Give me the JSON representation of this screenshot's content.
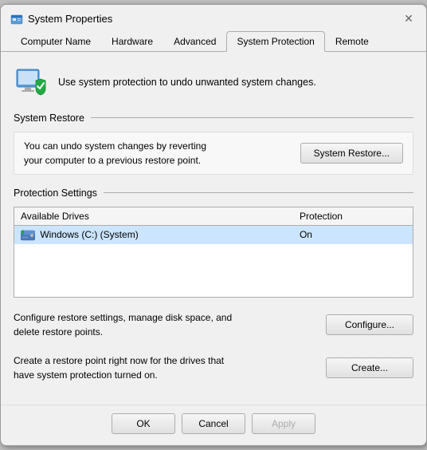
{
  "window": {
    "title": "System Properties",
    "close_label": "✕"
  },
  "tabs": [
    {
      "id": "computer-name",
      "label": "Computer Name",
      "active": false
    },
    {
      "id": "hardware",
      "label": "Hardware",
      "active": false
    },
    {
      "id": "advanced",
      "label": "Advanced",
      "active": false
    },
    {
      "id": "system-protection",
      "label": "System Protection",
      "active": true
    },
    {
      "id": "remote",
      "label": "Remote",
      "active": false
    }
  ],
  "intro": {
    "text": "Use system protection to undo unwanted system changes."
  },
  "system_restore": {
    "section_title": "System Restore",
    "description": "You can undo system changes by reverting\nyour computer to a previous restore point.",
    "button_label": "System Restore..."
  },
  "protection_settings": {
    "section_title": "Protection Settings",
    "table": {
      "columns": [
        "Available Drives",
        "Protection"
      ],
      "rows": [
        {
          "drive": "Windows (C:) (System)",
          "protection": "On",
          "selected": true
        }
      ]
    },
    "configure": {
      "description": "Configure restore settings, manage disk space, and\ndelete restore points.",
      "button_label": "Configure..."
    },
    "create": {
      "description": "Create a restore point right now for the drives that\nhave system protection turned on.",
      "button_label": "Create..."
    }
  },
  "footer": {
    "ok_label": "OK",
    "cancel_label": "Cancel",
    "apply_label": "Apply"
  },
  "colors": {
    "accent": "#0078d7",
    "selected_row": "#cce5ff",
    "disabled_text": "#adadad"
  }
}
